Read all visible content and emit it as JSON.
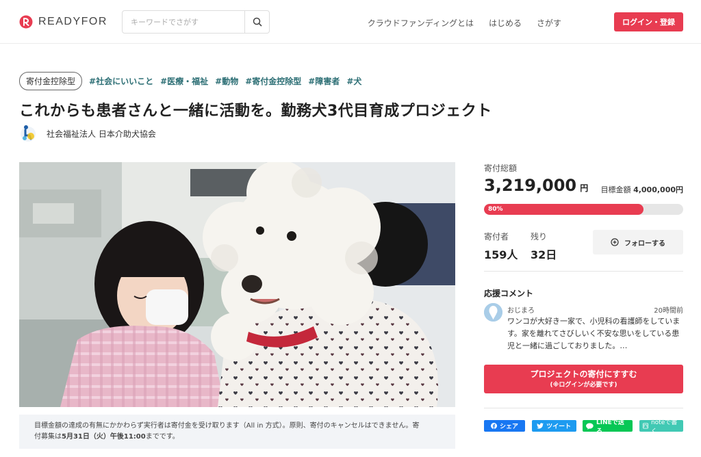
{
  "header": {
    "logo_text": "READYFOR",
    "search_placeholder": "キーワードでさがす",
    "nav": [
      "クラウドファンディングとは",
      "はじめる",
      "さがす"
    ],
    "login_label": "ログイン・登録",
    "brand_color": "#e83c51"
  },
  "project": {
    "type_tag": "寄付金控除型",
    "hashtags": [
      "#社会にいいこと",
      "#医療・福祉",
      "#動物",
      "#寄付金控除型",
      "#障害者",
      "#犬"
    ],
    "title": "これからも患者さんと一緒に活動を。勤務犬3代目育成プロジェクト",
    "organization": "社会福祉法人 日本介助犬協会"
  },
  "notice": {
    "text_a": "目標金額の達成の有無にかかわらず実行者は寄付金を受け取ります（All in 方式）。原則、寄付のキャンセルはできません。寄",
    "text_b": "付募集は",
    "text_bold": "5月31日（火）午後11:00",
    "text_c": "までです。"
  },
  "stats": {
    "total_label": "寄付総額",
    "total_amount": "3,219,000",
    "yen": "円",
    "goal_label": "目標金額",
    "goal_amount": "4,000,000円",
    "progress_label": "80%",
    "progress_fraction": 0.8,
    "supporters_label": "寄付者",
    "supporters_value": "159人",
    "remaining_label": "残り",
    "remaining_value": "32日",
    "follow_label": "フォローする"
  },
  "comment": {
    "section_title": "応援コメント",
    "author": "おじまろ",
    "time": "20時間前",
    "text": "ワンコが大好き一家で、小児科の看護師をしています。家を離れてさびしいく不安な思いをしている患児と一緒に過ごしておりました。…"
  },
  "cta": {
    "main": "プロジェクトの寄付にすすむ",
    "sub": "(※ログインが必要です)"
  },
  "share": {
    "facebook": "シェア",
    "twitter": "ツイート",
    "line": "LINEで送る",
    "note": "noteで書く"
  }
}
